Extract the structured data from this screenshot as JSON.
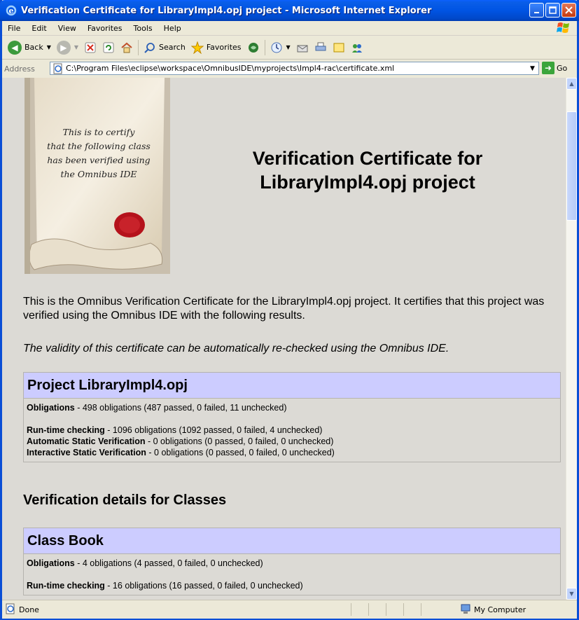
{
  "window": {
    "title": "Verification Certificate for LibraryImpl4.opj project - Microsoft Internet Explorer"
  },
  "menu": {
    "items": [
      "File",
      "Edit",
      "View",
      "Favorites",
      "Tools",
      "Help"
    ]
  },
  "toolbar": {
    "back_label": "Back",
    "search_label": "Search",
    "favorites_label": "Favorites"
  },
  "address": {
    "label": "Address",
    "url": "C:\\Program Files\\eclipse\\workspace\\OmnibusIDE\\myprojects\\Impl4-rac\\certificate.xml",
    "go_label": "Go"
  },
  "page": {
    "scroll_text_lines": [
      "This is to certify",
      "that the following class",
      "has been verified using",
      "the Omnibus IDE"
    ],
    "title_line1": "Verification Certificate for",
    "title_line2": "LibraryImpl4.opj project",
    "intro": "This is the Omnibus Verification Certificate for the LibraryImpl4.opj project. It certifies that this project was verified using the Omnibus IDE with the following results.",
    "validity": "The validity of this certificate can be automatically re-checked using the Omnibus IDE.",
    "project_box": {
      "heading": "Project LibraryImpl4.opj",
      "obligations_label": "Obligations",
      "obligations_text": " - 498 obligations (487 passed, 0 failed, 11 unchecked)",
      "rtc_label": "Run-time checking",
      "rtc_text": " - 1096 obligations (1092 passed, 0 failed, 4 unchecked)",
      "asv_label": "Automatic Static Verification",
      "asv_text": " - 0 obligations (0 passed, 0 failed, 0 unchecked)",
      "isv_label": "Interactive Static Verification",
      "isv_text": " - 0 obligations (0 passed, 0 failed, 0 unchecked)"
    },
    "section_title": "Verification details for Classes",
    "class_box": {
      "heading": "Class Book",
      "obligations_label": "Obligations",
      "obligations_text": " - 4 obligations (4 passed, 0 failed, 0 unchecked)",
      "rtc_label": "Run-time checking",
      "rtc_text": " - 16 obligations (16 passed, 0 failed, 0 unchecked)"
    }
  },
  "status": {
    "text": "Done",
    "zone": "My Computer"
  },
  "colors": {
    "title_bar": "#0054e3",
    "box_heading": "#ccccff",
    "content_bg": "#dcdad5"
  }
}
